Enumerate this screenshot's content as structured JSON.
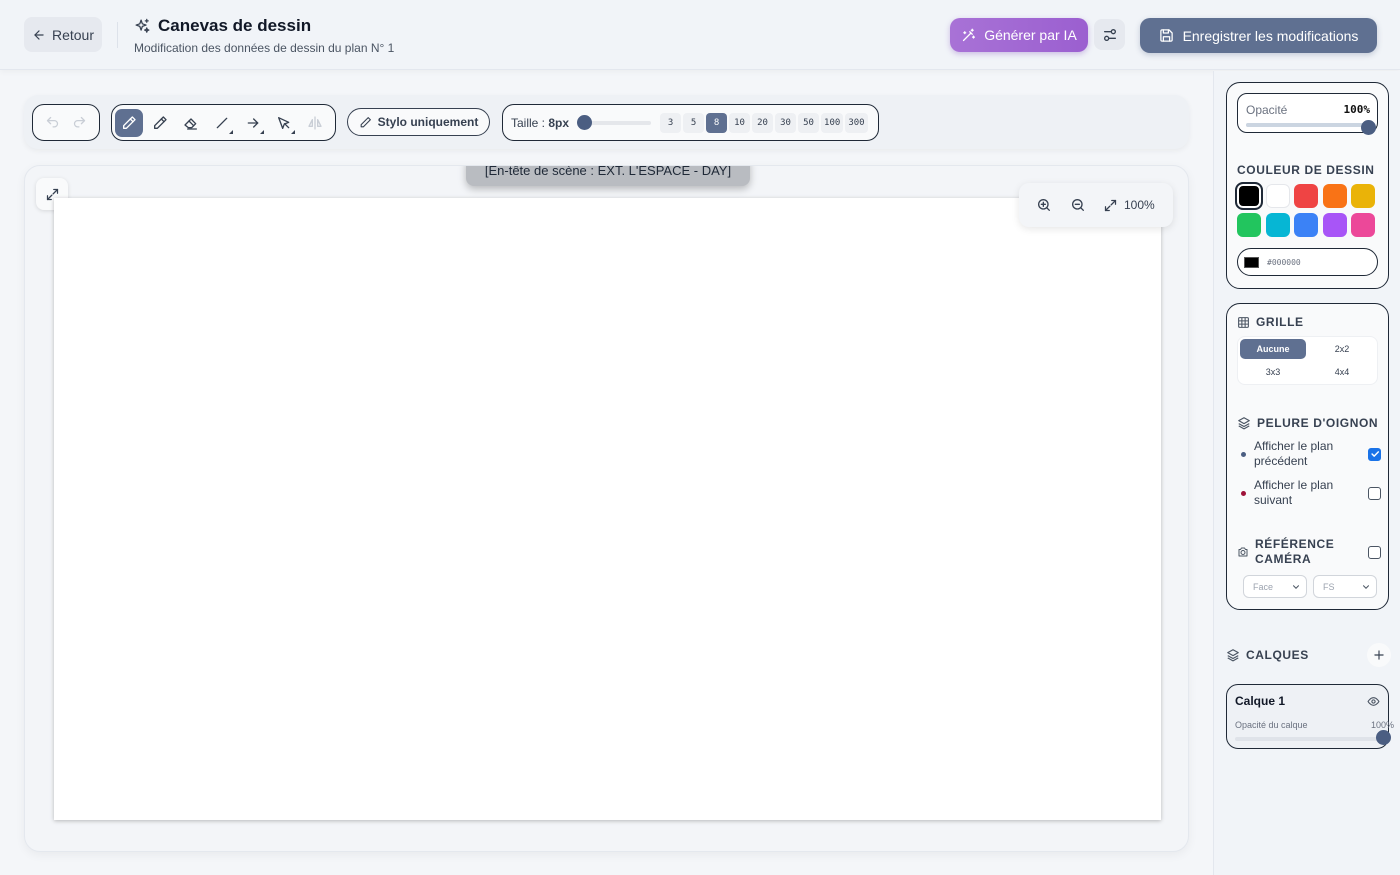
{
  "header": {
    "back_label": "Retour",
    "title": "Canevas de dessin",
    "subtitle": "Modification des données de dessin du plan N° 1",
    "ai_button_label": "Générer par IA",
    "save_button_label": "Enregistrer les modifications"
  },
  "toolbar": {
    "tools": [
      "pen-tool",
      "pencil-tool",
      "eraser-tool",
      "line-tool",
      "arrow-tool",
      "select-tool",
      "mirror-tool"
    ],
    "active_tool": "pen-tool",
    "pen_only_label": "Stylo uniquement",
    "size_label": "Taille :",
    "size_value": "8px",
    "size_presets": [
      "3",
      "5",
      "8",
      "10",
      "20",
      "30",
      "50",
      "100",
      "300"
    ],
    "active_preset": "8"
  },
  "canvas": {
    "scene_header": "[En-tête de scène : EXT. L'ESPACE - DAY]",
    "zoom_level": "100%"
  },
  "sidebar": {
    "opacity_label": "Opacité",
    "opacity_value": "100%",
    "opacity_fraction": 1.0,
    "color_section_title": "COULEUR DE DESSIN",
    "colors": [
      "#000000",
      "#ffffff",
      "#ef4444",
      "#f97316",
      "#eab308",
      "#22c55e",
      "#06b6d4",
      "#3b82f6",
      "#a855f7",
      "#ec4899"
    ],
    "selected_color": "#000000",
    "hex_value": "#000000",
    "grid_title": "GRILLE",
    "grid_options": [
      "Aucune",
      "2x2",
      "3x3",
      "4x4"
    ],
    "grid_active": "Aucune",
    "onion_title": "PELURE D'OIGNON",
    "onion_prev_label": "Afficher le plan précédent",
    "onion_prev_checked": true,
    "onion_prev_color": "#4b5e82",
    "onion_next_label": "Afficher le plan suivant",
    "onion_next_checked": false,
    "onion_next_color": "#9f1239",
    "camera_title": "RÉFÉRENCE CAMÉRA",
    "camera_checked": false,
    "camera_angle": "Face",
    "camera_shot": "FS"
  },
  "layers": {
    "title": "CALQUES",
    "items": [
      {
        "name": "Calque 1",
        "opacity_label": "Opacité du calque",
        "opacity_value": "100%",
        "opacity_fraction": 1.0
      }
    ]
  }
}
